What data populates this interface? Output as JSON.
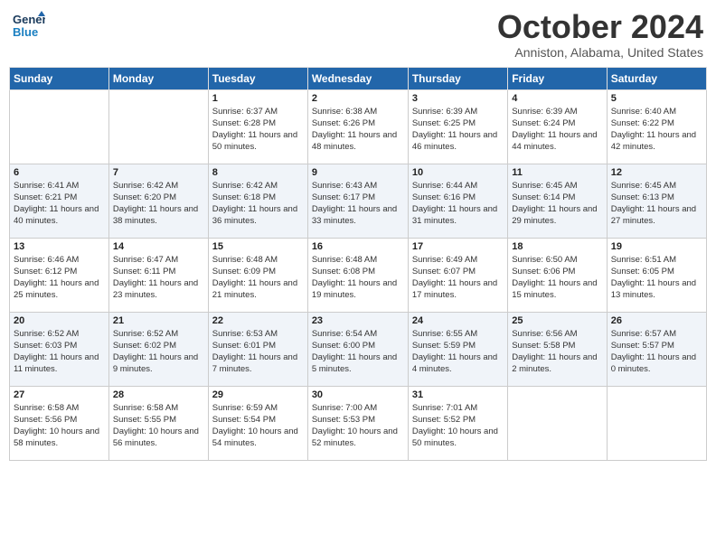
{
  "logo": {
    "line1": "General",
    "line2": "Blue"
  },
  "title": "October 2024",
  "subtitle": "Anniston, Alabama, United States",
  "days_header": [
    "Sunday",
    "Monday",
    "Tuesday",
    "Wednesday",
    "Thursday",
    "Friday",
    "Saturday"
  ],
  "weeks": [
    [
      {
        "day": "",
        "sunrise": "",
        "sunset": "",
        "daylight": ""
      },
      {
        "day": "",
        "sunrise": "",
        "sunset": "",
        "daylight": ""
      },
      {
        "day": "1",
        "sunrise": "Sunrise: 6:37 AM",
        "sunset": "Sunset: 6:28 PM",
        "daylight": "Daylight: 11 hours and 50 minutes."
      },
      {
        "day": "2",
        "sunrise": "Sunrise: 6:38 AM",
        "sunset": "Sunset: 6:26 PM",
        "daylight": "Daylight: 11 hours and 48 minutes."
      },
      {
        "day": "3",
        "sunrise": "Sunrise: 6:39 AM",
        "sunset": "Sunset: 6:25 PM",
        "daylight": "Daylight: 11 hours and 46 minutes."
      },
      {
        "day": "4",
        "sunrise": "Sunrise: 6:39 AM",
        "sunset": "Sunset: 6:24 PM",
        "daylight": "Daylight: 11 hours and 44 minutes."
      },
      {
        "day": "5",
        "sunrise": "Sunrise: 6:40 AM",
        "sunset": "Sunset: 6:22 PM",
        "daylight": "Daylight: 11 hours and 42 minutes."
      }
    ],
    [
      {
        "day": "6",
        "sunrise": "Sunrise: 6:41 AM",
        "sunset": "Sunset: 6:21 PM",
        "daylight": "Daylight: 11 hours and 40 minutes."
      },
      {
        "day": "7",
        "sunrise": "Sunrise: 6:42 AM",
        "sunset": "Sunset: 6:20 PM",
        "daylight": "Daylight: 11 hours and 38 minutes."
      },
      {
        "day": "8",
        "sunrise": "Sunrise: 6:42 AM",
        "sunset": "Sunset: 6:18 PM",
        "daylight": "Daylight: 11 hours and 36 minutes."
      },
      {
        "day": "9",
        "sunrise": "Sunrise: 6:43 AM",
        "sunset": "Sunset: 6:17 PM",
        "daylight": "Daylight: 11 hours and 33 minutes."
      },
      {
        "day": "10",
        "sunrise": "Sunrise: 6:44 AM",
        "sunset": "Sunset: 6:16 PM",
        "daylight": "Daylight: 11 hours and 31 minutes."
      },
      {
        "day": "11",
        "sunrise": "Sunrise: 6:45 AM",
        "sunset": "Sunset: 6:14 PM",
        "daylight": "Daylight: 11 hours and 29 minutes."
      },
      {
        "day": "12",
        "sunrise": "Sunrise: 6:45 AM",
        "sunset": "Sunset: 6:13 PM",
        "daylight": "Daylight: 11 hours and 27 minutes."
      }
    ],
    [
      {
        "day": "13",
        "sunrise": "Sunrise: 6:46 AM",
        "sunset": "Sunset: 6:12 PM",
        "daylight": "Daylight: 11 hours and 25 minutes."
      },
      {
        "day": "14",
        "sunrise": "Sunrise: 6:47 AM",
        "sunset": "Sunset: 6:11 PM",
        "daylight": "Daylight: 11 hours and 23 minutes."
      },
      {
        "day": "15",
        "sunrise": "Sunrise: 6:48 AM",
        "sunset": "Sunset: 6:09 PM",
        "daylight": "Daylight: 11 hours and 21 minutes."
      },
      {
        "day": "16",
        "sunrise": "Sunrise: 6:48 AM",
        "sunset": "Sunset: 6:08 PM",
        "daylight": "Daylight: 11 hours and 19 minutes."
      },
      {
        "day": "17",
        "sunrise": "Sunrise: 6:49 AM",
        "sunset": "Sunset: 6:07 PM",
        "daylight": "Daylight: 11 hours and 17 minutes."
      },
      {
        "day": "18",
        "sunrise": "Sunrise: 6:50 AM",
        "sunset": "Sunset: 6:06 PM",
        "daylight": "Daylight: 11 hours and 15 minutes."
      },
      {
        "day": "19",
        "sunrise": "Sunrise: 6:51 AM",
        "sunset": "Sunset: 6:05 PM",
        "daylight": "Daylight: 11 hours and 13 minutes."
      }
    ],
    [
      {
        "day": "20",
        "sunrise": "Sunrise: 6:52 AM",
        "sunset": "Sunset: 6:03 PM",
        "daylight": "Daylight: 11 hours and 11 minutes."
      },
      {
        "day": "21",
        "sunrise": "Sunrise: 6:52 AM",
        "sunset": "Sunset: 6:02 PM",
        "daylight": "Daylight: 11 hours and 9 minutes."
      },
      {
        "day": "22",
        "sunrise": "Sunrise: 6:53 AM",
        "sunset": "Sunset: 6:01 PM",
        "daylight": "Daylight: 11 hours and 7 minutes."
      },
      {
        "day": "23",
        "sunrise": "Sunrise: 6:54 AM",
        "sunset": "Sunset: 6:00 PM",
        "daylight": "Daylight: 11 hours and 5 minutes."
      },
      {
        "day": "24",
        "sunrise": "Sunrise: 6:55 AM",
        "sunset": "Sunset: 5:59 PM",
        "daylight": "Daylight: 11 hours and 4 minutes."
      },
      {
        "day": "25",
        "sunrise": "Sunrise: 6:56 AM",
        "sunset": "Sunset: 5:58 PM",
        "daylight": "Daylight: 11 hours and 2 minutes."
      },
      {
        "day": "26",
        "sunrise": "Sunrise: 6:57 AM",
        "sunset": "Sunset: 5:57 PM",
        "daylight": "Daylight: 11 hours and 0 minutes."
      }
    ],
    [
      {
        "day": "27",
        "sunrise": "Sunrise: 6:58 AM",
        "sunset": "Sunset: 5:56 PM",
        "daylight": "Daylight: 10 hours and 58 minutes."
      },
      {
        "day": "28",
        "sunrise": "Sunrise: 6:58 AM",
        "sunset": "Sunset: 5:55 PM",
        "daylight": "Daylight: 10 hours and 56 minutes."
      },
      {
        "day": "29",
        "sunrise": "Sunrise: 6:59 AM",
        "sunset": "Sunset: 5:54 PM",
        "daylight": "Daylight: 10 hours and 54 minutes."
      },
      {
        "day": "30",
        "sunrise": "Sunrise: 7:00 AM",
        "sunset": "Sunset: 5:53 PM",
        "daylight": "Daylight: 10 hours and 52 minutes."
      },
      {
        "day": "31",
        "sunrise": "Sunrise: 7:01 AM",
        "sunset": "Sunset: 5:52 PM",
        "daylight": "Daylight: 10 hours and 50 minutes."
      },
      {
        "day": "",
        "sunrise": "",
        "sunset": "",
        "daylight": ""
      },
      {
        "day": "",
        "sunrise": "",
        "sunset": "",
        "daylight": ""
      }
    ]
  ]
}
